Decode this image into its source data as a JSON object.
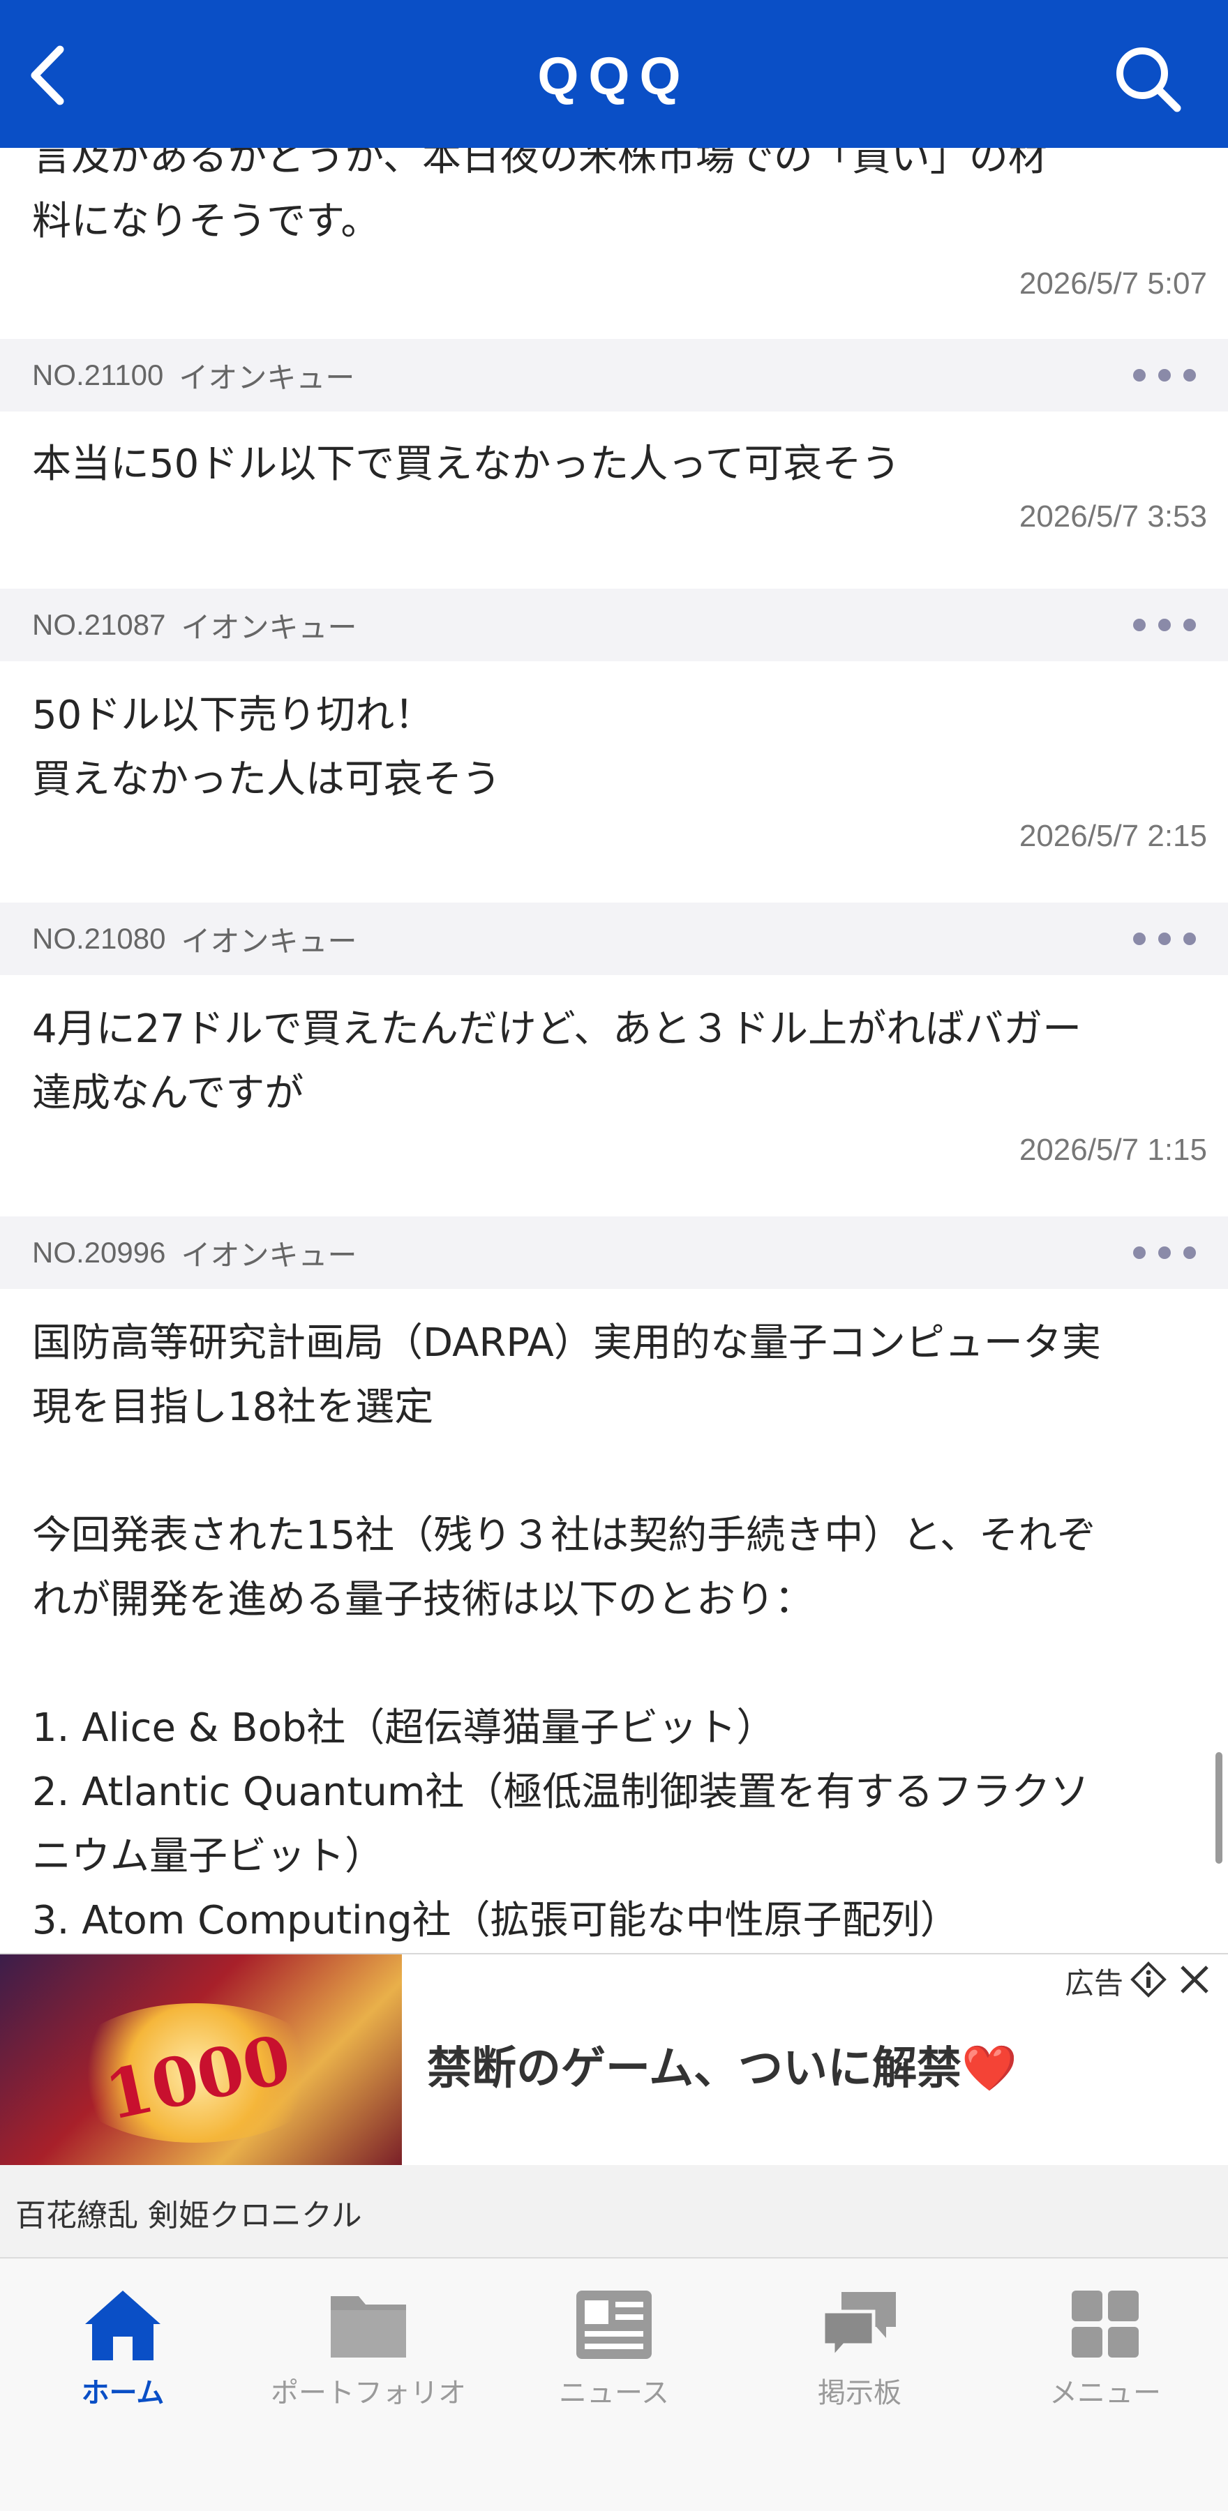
{
  "header": {
    "title": "QQQ"
  },
  "posts": [
    {
      "body": "言及があるかどうか、本日夜の米株市場での「買い」の材\n料になりそうです。",
      "timestamp": "2026/5/7 5:07"
    },
    {
      "number": "NO.21100",
      "user": "イオンキュー",
      "body": "本当に50ドル以下で買えなかった人って可哀そう",
      "timestamp": "2026/5/7 3:53"
    },
    {
      "number": "NO.21087",
      "user": "イオンキュー",
      "body": "50ドル以下売り切れ！\n買えなかった人は可哀そう",
      "timestamp": "2026/5/7 2:15"
    },
    {
      "number": "NO.21080",
      "user": "イオンキュー",
      "body": "4月に27ドルで買えたんだけど、あと３ドル上がればバガー\n達成なんですが",
      "timestamp": "2026/5/7 1:15"
    },
    {
      "number": "NO.20996",
      "user": "イオンキュー",
      "body": "国防高等研究計画局（DARPA）実用的な量子コンピュータ実\n現を目指し18社を選定\n\n今回発表された15社（残り３社は契約手続き中）と、それぞ\nれが開発を進める量子技術は以下のとおり：\n\n1. Alice & Bob社（超伝導猫量子ビット）\n2. Atlantic Quantum社（極低温制御装置を有するフラクソ\nニウム量子ビット）\n3. Atom Computing社（拡張可能な中性原子配列）"
    }
  ],
  "ad": {
    "label": "広告",
    "headline": "禁断のゲーム、ついに解禁",
    "heart": "❤️",
    "sponsor": "百花繚乱 剣姫クロニクル",
    "image_text": "1000"
  },
  "tabbar": {
    "tabs": [
      {
        "label": "ホーム",
        "icon": "home-icon",
        "active": true
      },
      {
        "label": "ポートフォリオ",
        "icon": "folder-icon",
        "active": false
      },
      {
        "label": "ニュース",
        "icon": "newspaper-icon",
        "active": false
      },
      {
        "label": "掲示板",
        "icon": "chat-bubbles-icon",
        "active": false
      },
      {
        "label": "メニュー",
        "icon": "grid-icon",
        "active": false
      }
    ]
  },
  "colors": {
    "brand": "#0a4fc6",
    "inactive": "#9a9a9a"
  }
}
